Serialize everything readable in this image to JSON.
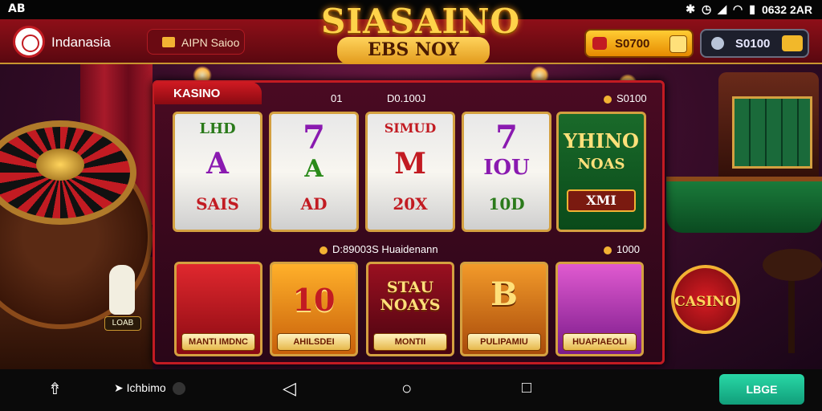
{
  "status_bar": {
    "left_icon": "AB",
    "time": "0632 2AR"
  },
  "header": {
    "brand": "Indanasia",
    "promo_label": "AIPN Saioo",
    "title": "SIASAINO",
    "subtitle": "EBS NOY",
    "coins": "S0700",
    "balance": "S0100"
  },
  "panel": {
    "tab": "KASINO",
    "row1_left": "01",
    "row1_center": "D0.100J",
    "row1_right": "S0100",
    "row2_center": "D:89003S Huaidenann",
    "row2_right": "1000"
  },
  "reels": [
    {
      "top": "LHD",
      "mid": "A",
      "bot": "SAIS"
    },
    {
      "top": "7",
      "mid": "A",
      "bot": "AD"
    },
    {
      "top": "SIMUD",
      "mid": "M",
      "bot": "20X"
    },
    {
      "top": "7",
      "mid": "IOU",
      "bot": "10D"
    },
    {
      "top": "YHINO",
      "mid": "NOAS",
      "bot": "XMI"
    }
  ],
  "cards": [
    {
      "art": "",
      "label": "MANTI IMDNC",
      "bg": "#c21b22"
    },
    {
      "art": "10",
      "label": "AHILSDEI",
      "bg": "#e68a10"
    },
    {
      "art": "STAU NOAYS",
      "label": "MONTII",
      "bg": "#7a0a16"
    },
    {
      "art": "B",
      "label": "PULIPAMIU",
      "bg": "#d8701a"
    },
    {
      "art": "",
      "label": "HUAPIAEOLI",
      "bg": "#c23ab0"
    }
  ],
  "scene": {
    "dog_tag": "LOAB",
    "casino_badge": "CASINO"
  },
  "navbar": {
    "app_label": "Ichbimo",
    "action_button": "LBGE"
  },
  "colors": {
    "accent": "#c21b22",
    "gold": "#f2b233",
    "action": "#1fb98d"
  }
}
